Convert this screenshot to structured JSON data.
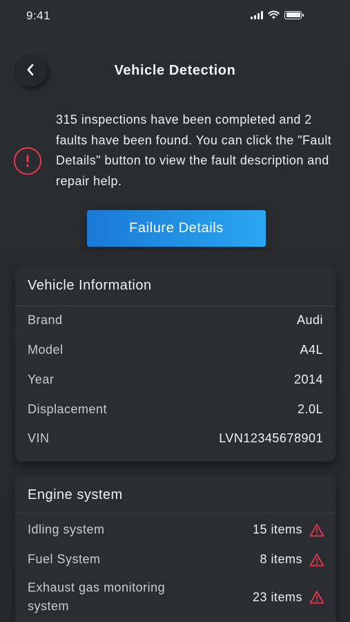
{
  "status_bar": {
    "time": "9:41"
  },
  "header": {
    "title": "Vehicle Detection"
  },
  "alert": {
    "message": "315 inspections have been completed and 2 faults have been found. You can click the \"Fault Details\" button to view the fault description and repair help."
  },
  "actions": {
    "failure_details_label": "Failure Details"
  },
  "vehicle_info": {
    "title": "Vehicle Information",
    "rows": [
      {
        "label": "Brand",
        "value": "Audi"
      },
      {
        "label": "Model",
        "value": "A4L"
      },
      {
        "label": "Year",
        "value": "2014"
      },
      {
        "label": "Displacement",
        "value": "2.0L"
      },
      {
        "label": "VIN",
        "value": "LVN12345678901"
      }
    ]
  },
  "engine_system": {
    "title": "Engine system",
    "items": [
      {
        "label": "Idling system",
        "count": "15 items",
        "icon": "warning-triangle-icon"
      },
      {
        "label": "Fuel System",
        "count": "8 items",
        "icon": "warning-triangle-icon"
      },
      {
        "label": "Exhaust gas monitoring system",
        "count": "23 items",
        "icon": "warning-triangle-icon"
      }
    ]
  },
  "colors": {
    "background": "#2a2c30",
    "card": "#2b2d32",
    "accent_start": "#1a79d6",
    "accent_end": "#2aa6f1",
    "danger": "#e5384f"
  }
}
